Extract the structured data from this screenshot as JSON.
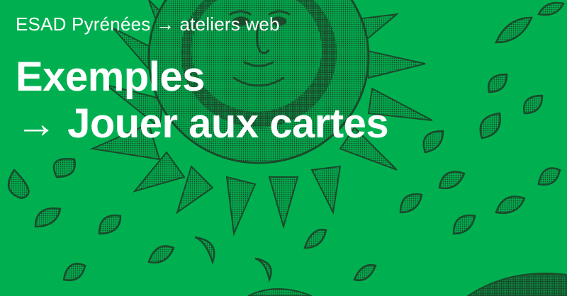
{
  "banner": {
    "kicker": "ESAD Pyrénées → ateliers web",
    "title_line1": "Exemples",
    "title_line2": "→ Jouer aux cartes"
  },
  "colors": {
    "background": "#00b050",
    "ink": "#1a4a2a",
    "text": "#ffffff"
  },
  "icons": [
    "sun-face-illustration",
    "leaf-drop-icon"
  ]
}
